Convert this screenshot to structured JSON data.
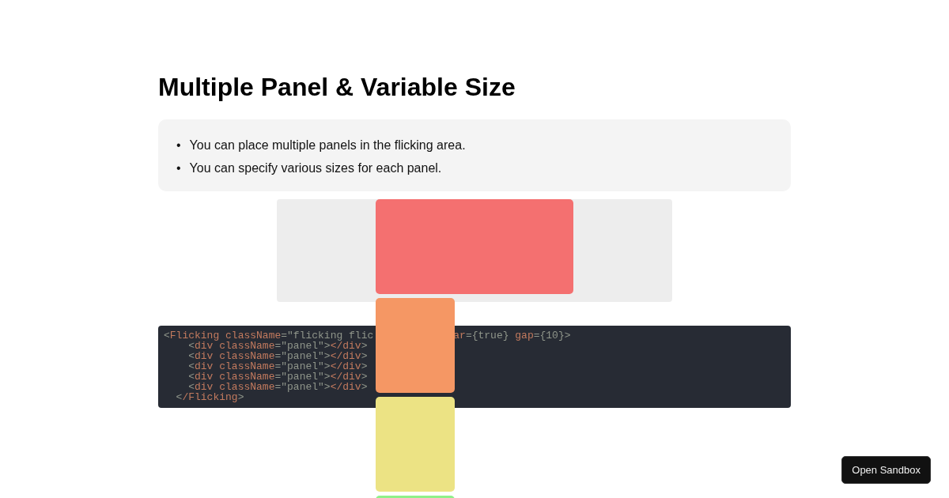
{
  "title": "Multiple Panel & Variable Size",
  "notes": [
    {
      "bullet": "•",
      "text": "You can place multiple panels in the flicking area."
    },
    {
      "bullet": "•",
      "text": "You can specify various sizes for each panel."
    }
  ],
  "panels": [
    {
      "kind": "wide",
      "color": "#f47070"
    },
    {
      "kind": "narrow",
      "color": "#f59764"
    },
    {
      "kind": "narrow",
      "color": "#ece384"
    },
    {
      "kind": "narrow",
      "color": "#8ff08a"
    }
  ],
  "code": {
    "first_line": [
      [
        {
          "kind": "punct",
          "text": "<"
        },
        {
          "kind": "tag",
          "text": "Flicking"
        },
        {
          "kind": "tag",
          "text": " className"
        },
        {
          "kind": "punct",
          "text": "=\"flicking flic"
        }
      ],
      [
        {
          "kind": "tag",
          "text": "ar"
        },
        {
          "kind": "punct",
          "text": "={true} "
        },
        {
          "kind": "tag",
          "text": "gap"
        },
        {
          "kind": "punct",
          "text": "={10}>"
        }
      ]
    ],
    "lines": [
      [
        {
          "kind": "punct",
          "text": "    <"
        },
        {
          "kind": "tag",
          "text": "div"
        },
        {
          "kind": "tag",
          "text": " className"
        },
        {
          "kind": "punct",
          "text": "=\"panel\">"
        },
        {
          "kind": "tag",
          "text": "</div"
        },
        {
          "kind": "punct",
          "text": ">"
        }
      ],
      [
        {
          "kind": "punct",
          "text": "    <"
        },
        {
          "kind": "tag",
          "text": "div"
        },
        {
          "kind": "tag",
          "text": " className"
        },
        {
          "kind": "punct",
          "text": "=\"panel\">"
        },
        {
          "kind": "tag",
          "text": "</div"
        },
        {
          "kind": "punct",
          "text": ">"
        }
      ],
      [
        {
          "kind": "punct",
          "text": "    <"
        },
        {
          "kind": "tag",
          "text": "div"
        },
        {
          "kind": "tag",
          "text": " className"
        },
        {
          "kind": "punct",
          "text": "=\"panel\">"
        },
        {
          "kind": "tag",
          "text": "</div"
        },
        {
          "kind": "punct",
          "text": ">"
        }
      ],
      [
        {
          "kind": "punct",
          "text": "    <"
        },
        {
          "kind": "tag",
          "text": "div"
        },
        {
          "kind": "tag",
          "text": " className"
        },
        {
          "kind": "punct",
          "text": "=\"panel\">"
        },
        {
          "kind": "tag",
          "text": "</div"
        },
        {
          "kind": "punct",
          "text": ">"
        }
      ],
      [
        {
          "kind": "punct",
          "text": "    <"
        },
        {
          "kind": "tag",
          "text": "div"
        },
        {
          "kind": "tag",
          "text": " className"
        },
        {
          "kind": "punct",
          "text": "=\"panel\">"
        },
        {
          "kind": "tag",
          "text": "</div"
        },
        {
          "kind": "punct",
          "text": ">"
        }
      ],
      [
        {
          "kind": "punct",
          "text": "  <"
        },
        {
          "kind": "tag",
          "text": "/Flicking"
        },
        {
          "kind": "punct",
          "text": ">"
        }
      ]
    ]
  },
  "sandbox_button": "Open Sandbox"
}
